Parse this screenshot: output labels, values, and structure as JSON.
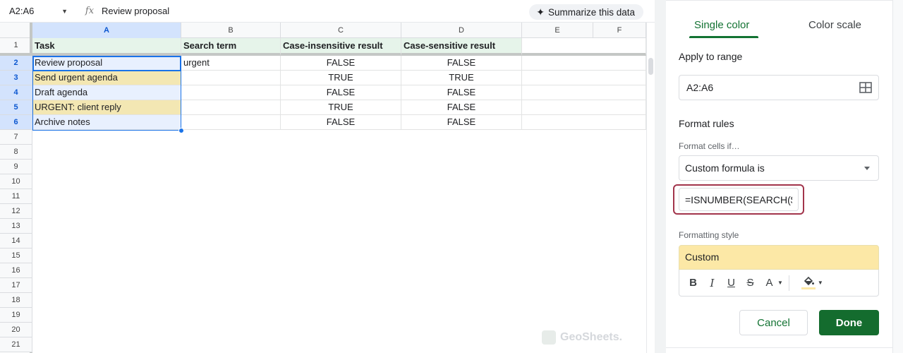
{
  "formula_bar": {
    "name_box": "A2:A6",
    "fx_label": "fx",
    "content": "Review proposal",
    "summarize_label": "Summarize this data"
  },
  "grid": {
    "columns": [
      "A",
      "B",
      "C",
      "D",
      "E",
      "F"
    ],
    "rows": [
      "1",
      "2",
      "3",
      "4",
      "5",
      "6",
      "7",
      "8",
      "9",
      "10",
      "11",
      "12",
      "13",
      "14",
      "15",
      "16",
      "17",
      "18",
      "19",
      "20",
      "21"
    ],
    "header": [
      "Task",
      "Search term",
      "Case-insensitive result",
      "Case-sensitive result"
    ],
    "data": [
      [
        "Review proposal",
        "urgent",
        "FALSE",
        "FALSE"
      ],
      [
        "Send urgent agenda",
        "",
        "TRUE",
        "TRUE"
      ],
      [
        "Draft agenda",
        "",
        "FALSE",
        "FALSE"
      ],
      [
        "URGENT: client reply",
        "",
        "TRUE",
        "FALSE"
      ],
      [
        "Archive notes",
        "",
        "FALSE",
        "FALSE"
      ]
    ],
    "highlight_color": "#f3e7b3",
    "header_fill": "#e6f4ea",
    "selection_color": "#1a73e8"
  },
  "watermark": "GeoSheets.",
  "panel": {
    "tabs": [
      "Single color",
      "Color scale"
    ],
    "apply_to_range_label": "Apply to range",
    "range_value": "A2:A6",
    "format_rules_label": "Format rules",
    "format_cells_if_label": "Format cells if…",
    "condition_value": "Custom formula is",
    "formula_value": "=ISNUMBER(SEARCH($E",
    "formatting_style_label": "Formatting style",
    "style_preview": "Custom",
    "toolbar": {
      "bold": "B",
      "italic": "I",
      "underline": "U",
      "strike": "S",
      "text_color": "A"
    },
    "cancel_label": "Cancel",
    "done_label": "Done",
    "accent_color": "#137333"
  }
}
